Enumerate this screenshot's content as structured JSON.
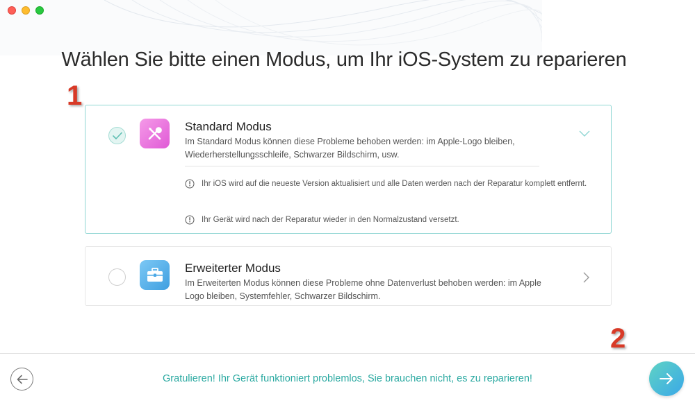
{
  "header": {
    "title": "Wählen Sie bitte einen Modus, um Ihr iOS-System zu reparieren"
  },
  "annotations": [
    "1",
    "2"
  ],
  "modes": {
    "standard": {
      "title": "Standard Modus",
      "description": "Im Standard Modus können diese Probleme behoben werden: im Apple-Logo bleiben, Wiederherstellungsschleife, Schwarzer Bildschirm, usw.",
      "selected": true,
      "icon": "tools-icon",
      "notes": [
        "Ihr iOS wird auf die neueste Version aktualisiert und alle Daten werden nach der Reparatur komplett entfernt.",
        "Ihr Gerät wird nach der Reparatur wieder in den Normalzustand versetzt."
      ]
    },
    "advanced": {
      "title": "Erweiterter Modus",
      "description": "Im Erweiterten Modus können diese Probleme ohne Datenverlust behoben werden: im Apple Logo bleiben, Systemfehler, Schwarzer Bildschirm.",
      "selected": false,
      "icon": "toolbox-icon"
    }
  },
  "footer": {
    "status": "Gratulieren! Ihr Gerät funktioniert problemlos, Sie brauchen nicht, es zu reparieren!"
  },
  "colors": {
    "accent_teal": "#2aa9a1",
    "selected_border": "#8fd6d3",
    "annotation_red": "#d83a27"
  }
}
